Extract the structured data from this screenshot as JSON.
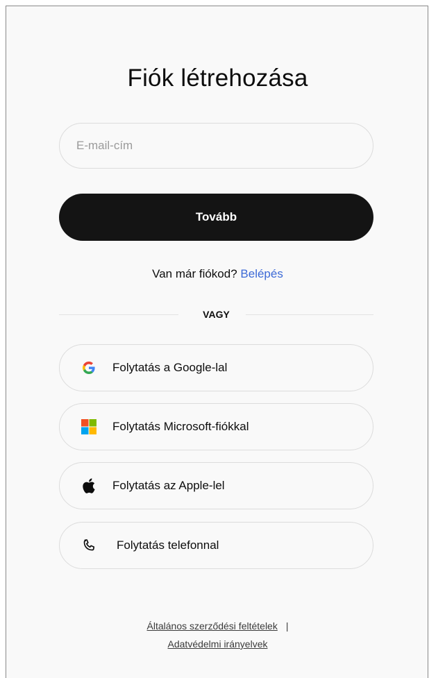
{
  "page": {
    "title": "Fiók létrehozása"
  },
  "form": {
    "email_placeholder": "E-mail-cím",
    "email_value": "",
    "continue_label": "Tovább"
  },
  "login": {
    "prompt": "Van már fiókod?",
    "link_label": "Belépés"
  },
  "divider": {
    "label": "VAGY"
  },
  "social": [
    {
      "label": "Folytatás a Google-lal",
      "icon": "google-icon"
    },
    {
      "label": "Folytatás Microsoft-fiókkal",
      "icon": "microsoft-icon"
    },
    {
      "label": "Folytatás az Apple-lel",
      "icon": "apple-icon"
    },
    {
      "label": "Folytatás telefonnal",
      "icon": "phone-icon"
    }
  ],
  "footer": {
    "terms_label": "Általános szerződési feltételek",
    "separator": "|",
    "privacy_label": "Adatvédelmi irányelvek"
  },
  "colors": {
    "background": "#f9f9f9",
    "primary_button": "#141414",
    "link": "#3d6ad6",
    "border": "#dcdcdc"
  }
}
